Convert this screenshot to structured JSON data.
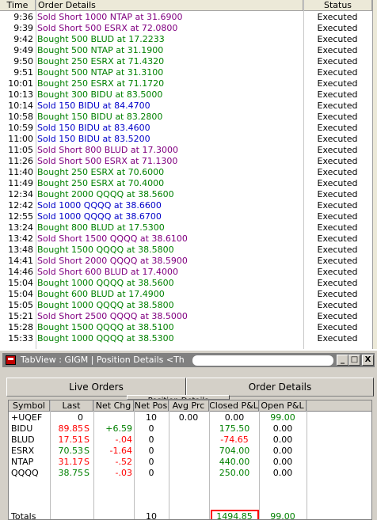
{
  "log": {
    "headers": {
      "time": "Time",
      "detail": "Order Details",
      "status": "Status"
    },
    "rows": [
      {
        "time": "9:36",
        "detail": "Sold Short 1000 NTAP at 31.6900",
        "status": "Executed",
        "kind": "short"
      },
      {
        "time": "9:39",
        "detail": "Sold Short 500 ESRX at 72.0800",
        "status": "Executed",
        "kind": "short"
      },
      {
        "time": "9:42",
        "detail": "Bought 500 BLUD at 17.2233",
        "status": "Executed",
        "kind": "buy"
      },
      {
        "time": "9:49",
        "detail": "Bought 500 NTAP at 31.1900",
        "status": "Executed",
        "kind": "buy"
      },
      {
        "time": "9:50",
        "detail": "Bought 250 ESRX at 71.4320",
        "status": "Executed",
        "kind": "buy"
      },
      {
        "time": "9:51",
        "detail": "Bought 500 NTAP at 31.3100",
        "status": "Executed",
        "kind": "buy"
      },
      {
        "time": "10:01",
        "detail": "Bought 250 ESRX at 71.1720",
        "status": "Executed",
        "kind": "buy"
      },
      {
        "time": "10:13",
        "detail": "Bought 300 BIDU at 83.5000",
        "status": "Executed",
        "kind": "buy"
      },
      {
        "time": "10:14",
        "detail": "Sold 150 BIDU at 84.4700",
        "status": "Executed",
        "kind": "sell"
      },
      {
        "time": "10:58",
        "detail": "Bought 150 BIDU at 83.2800",
        "status": "Executed",
        "kind": "buy"
      },
      {
        "time": "10:59",
        "detail": "Sold 150 BIDU at 83.4600",
        "status": "Executed",
        "kind": "sell"
      },
      {
        "time": "11:00",
        "detail": "Sold 150 BIDU at 83.5200",
        "status": "Executed",
        "kind": "sell"
      },
      {
        "time": "11:05",
        "detail": "Sold Short 800 BLUD at 17.3000",
        "status": "Executed",
        "kind": "short"
      },
      {
        "time": "11:26",
        "detail": "Sold Short 500 ESRX at 71.1300",
        "status": "Executed",
        "kind": "short"
      },
      {
        "time": "11:40",
        "detail": "Bought 250 ESRX at 70.6000",
        "status": "Executed",
        "kind": "buy"
      },
      {
        "time": "11:49",
        "detail": "Bought 250 ESRX at 70.4000",
        "status": "Executed",
        "kind": "buy"
      },
      {
        "time": "12:34",
        "detail": "Bought 2000 QQQQ at 38.5600",
        "status": "Executed",
        "kind": "buy"
      },
      {
        "time": "12:42",
        "detail": "Sold 1000 QQQQ at 38.6600",
        "status": "Executed",
        "kind": "sell"
      },
      {
        "time": "12:55",
        "detail": "Sold 1000 QQQQ at 38.6700",
        "status": "Executed",
        "kind": "sell"
      },
      {
        "time": "13:24",
        "detail": "Bought 800 BLUD at 17.5300",
        "status": "Executed",
        "kind": "buy"
      },
      {
        "time": "13:42",
        "detail": "Sold Short 1500 QQQQ at 38.6100",
        "status": "Executed",
        "kind": "short"
      },
      {
        "time": "13:48",
        "detail": "Bought 1500 QQQQ at 38.5800",
        "status": "Executed",
        "kind": "buy"
      },
      {
        "time": "14:41",
        "detail": "Sold Short 2000 QQQQ at 38.5900",
        "status": "Executed",
        "kind": "short"
      },
      {
        "time": "14:46",
        "detail": "Sold Short 600 BLUD at 17.4000",
        "status": "Executed",
        "kind": "short"
      },
      {
        "time": "15:04",
        "detail": "Bought 1000 QQQQ at 38.5600",
        "status": "Executed",
        "kind": "buy"
      },
      {
        "time": "15:04",
        "detail": "Bought 600 BLUD at 17.4900",
        "status": "Executed",
        "kind": "buy"
      },
      {
        "time": "15:05",
        "detail": "Bought 1000 QQQQ at 38.5800",
        "status": "Executed",
        "kind": "buy"
      },
      {
        "time": "15:21",
        "detail": "Sold Short 2500 QQQQ at 38.5000",
        "status": "Executed",
        "kind": "short"
      },
      {
        "time": "15:28",
        "detail": "Bought 1500 QQQQ at 38.5100",
        "status": "Executed",
        "kind": "buy"
      },
      {
        "time": "15:33",
        "detail": "Bought 1000 QQQQ at 38.5300",
        "status": "Executed",
        "kind": "buy"
      }
    ]
  },
  "window": {
    "title": "TabView : GIGM | Position Details <Th",
    "buttons": {
      "minimize": "_",
      "maximize": "□",
      "close": "X"
    }
  },
  "tabs": {
    "live_orders": "Live Orders",
    "order_details": "Order Details",
    "position_details": "Position Details"
  },
  "grid": {
    "headers": {
      "symbol": "Symbol",
      "last": "Last",
      "net_chg": "Net Chg",
      "net_pos": "Net Pos",
      "avg_prc": "Avg Prc",
      "closed_pl": "Closed P&L",
      "open_pl": "Open P&L"
    },
    "rows": [
      {
        "symbol": "+UQEF",
        "last": "0",
        "flag": "",
        "net_chg": "",
        "net_pos": "10",
        "avg_prc": "0.00",
        "closed_pl": "0.00",
        "open_pl": "99.00",
        "last_color": "black",
        "chg_color": "black",
        "closed_color": "black",
        "open_color": "green"
      },
      {
        "symbol": "BIDU",
        "last": "89.85",
        "flag": "S",
        "net_chg": "+6.59",
        "net_pos": "0",
        "avg_prc": "",
        "closed_pl": "175.50",
        "open_pl": "0.00",
        "last_color": "red",
        "chg_color": "green",
        "closed_color": "green",
        "open_color": "black"
      },
      {
        "symbol": "BLUD",
        "last": "17.51",
        "flag": "S",
        "net_chg": "-.04",
        "net_pos": "0",
        "avg_prc": "",
        "closed_pl": "-74.65",
        "open_pl": "0.00",
        "last_color": "red",
        "chg_color": "red",
        "closed_color": "red",
        "open_color": "black"
      },
      {
        "symbol": "ESRX",
        "last": "70.53",
        "flag": "S",
        "net_chg": "-1.64",
        "net_pos": "0",
        "avg_prc": "",
        "closed_pl": "704.00",
        "open_pl": "0.00",
        "last_color": "green",
        "chg_color": "red",
        "closed_color": "green",
        "open_color": "black"
      },
      {
        "symbol": "NTAP",
        "last": "31.17",
        "flag": "S",
        "net_chg": "-.52",
        "net_pos": "0",
        "avg_prc": "",
        "closed_pl": "440.00",
        "open_pl": "0.00",
        "last_color": "red",
        "chg_color": "red",
        "closed_color": "green",
        "open_color": "black"
      },
      {
        "symbol": "QQQQ",
        "last": "38.75",
        "flag": "S",
        "net_chg": "-.03",
        "net_pos": "0",
        "avg_prc": "",
        "closed_pl": "250.00",
        "open_pl": "0.00",
        "last_color": "green",
        "chg_color": "red",
        "closed_color": "green",
        "open_color": "black"
      }
    ],
    "totals": {
      "label": "Totals",
      "net_pos": "10",
      "closed_pl": "1494.85",
      "open_pl": "99.00"
    }
  }
}
